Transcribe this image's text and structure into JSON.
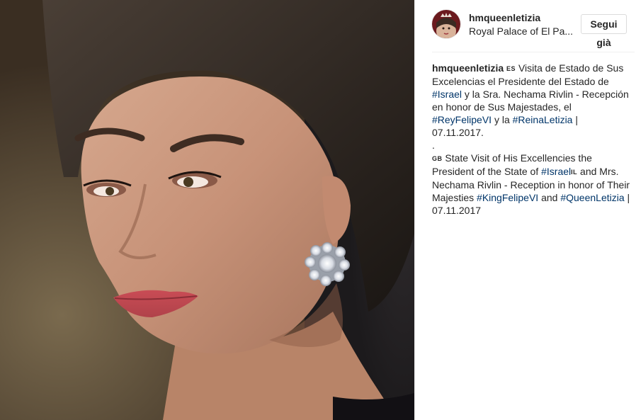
{
  "post": {
    "username": "hmqueenletizia",
    "location": "Royal Palace of El Pa...",
    "follow_label": "Segui già"
  },
  "caption": {
    "author": "hmqueenletizia",
    "es_flag": "ES",
    "es_text_1": "Visita de Estado de Sus Excelencias el Presidente del Estado de",
    "tag_israel": "#Israel",
    "es_text_2": "y la Sra. Nechama Rivlin - Recepción en honor de Sus Majestades, el",
    "tag_rey": "#ReyFelipeVI",
    "es_text_3": "y la",
    "tag_reina": "#ReinaLetizia",
    "es_text_4": "| 07.11.2017.",
    "separator": ".",
    "gb_flag": "GB",
    "gb_text_1": "State Visit of His Excellencies the President of the State of",
    "tag_israel_il": "#Israel",
    "il_flag": "IL",
    "gb_text_2": "and Mrs. Nechama Rivlin - Reception in honor of Their Majesties",
    "tag_king": "#KingFelipeVI",
    "gb_text_3": "and",
    "tag_queen": "#QueenLetizia",
    "gb_text_4": "| 07.11.2017"
  },
  "colors": {
    "hashtag": "#003569",
    "text": "#262626",
    "border": "#dbdbdb"
  },
  "icons": {
    "avatar": "profile-photo-crown"
  }
}
